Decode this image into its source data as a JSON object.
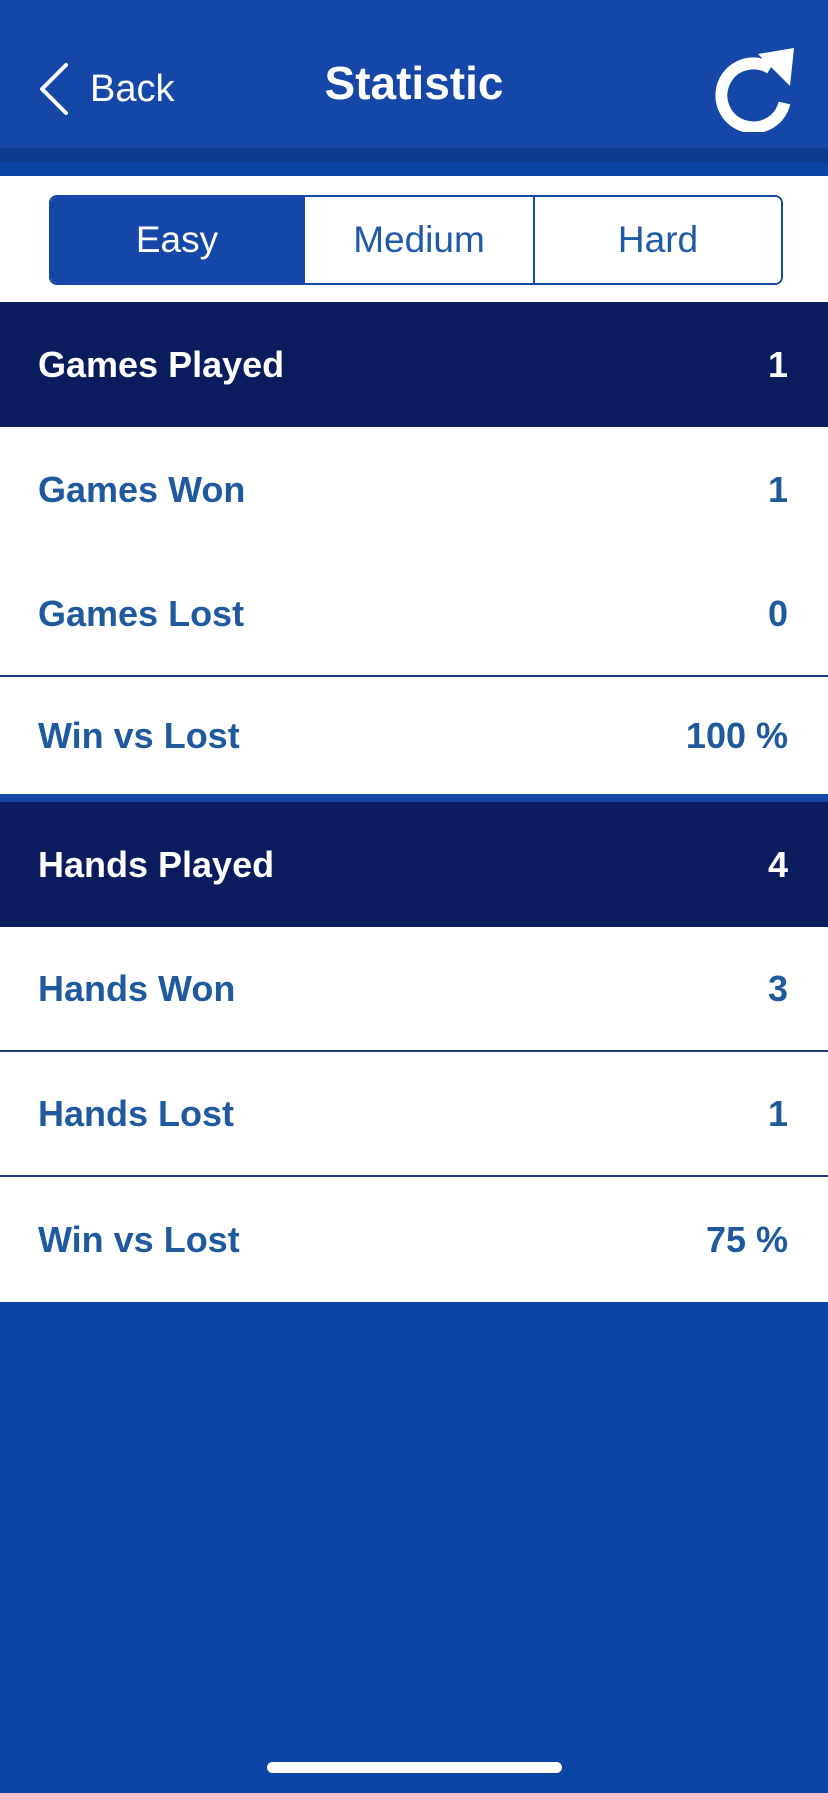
{
  "header": {
    "back_label": "Back",
    "title": "Statistic",
    "refresh_icon": "refresh-icon"
  },
  "difficulty_tabs": [
    {
      "label": "Easy",
      "selected": true
    },
    {
      "label": "Medium",
      "selected": false
    },
    {
      "label": "Hard",
      "selected": false
    }
  ],
  "games": {
    "played": {
      "label": "Games Played",
      "value": "1"
    },
    "won": {
      "label": "Games Won",
      "value": "1"
    },
    "lost": {
      "label": "Games Lost",
      "value": "0"
    },
    "ratio": {
      "label": "Win vs Lost",
      "value": "100 %"
    }
  },
  "hands": {
    "played": {
      "label": "Hands Played",
      "value": "4"
    },
    "won": {
      "label": "Hands Won",
      "value": "3"
    },
    "lost": {
      "label": "Hands Lost",
      "value": "1"
    },
    "ratio": {
      "label": "Win vs Lost",
      "value": "75 %"
    }
  },
  "colors": {
    "background": "#0b45a3",
    "header": "#1447a8",
    "section_header": "#0b1c5e",
    "text_blue": "#1f5a9e",
    "white": "#ffffff"
  }
}
